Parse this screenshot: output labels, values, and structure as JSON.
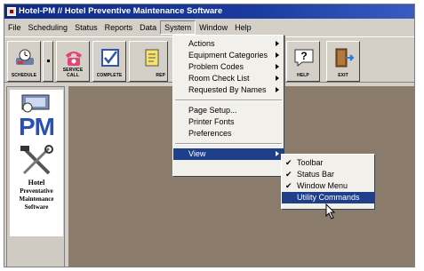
{
  "window": {
    "title": "Hotel-PM // Hotel Preventive Maintenance Software"
  },
  "menubar": {
    "items": [
      "File",
      "Scheduling",
      "Status",
      "Reports",
      "Data",
      "System",
      "Window",
      "Help"
    ]
  },
  "toolbar": {
    "schedule_label": "SCHEDULE",
    "service_call_label": "SERVICE CALL",
    "complete_label": "COMPLETE",
    "reports_label": "REP",
    "help_label": "HELP",
    "exit_label": "EXIT"
  },
  "logo": {
    "letters": "PM",
    "line1": "Hotel",
    "line2": "Preventative",
    "line3": "Maintenance",
    "line4": "Software"
  },
  "system_menu": {
    "group1": [
      "Actions",
      "Equipment Categories",
      "Problem Codes",
      "Room Check List",
      "Requested By Names"
    ],
    "group2": [
      "Page Setup...",
      "Printer Fonts",
      "Preferences"
    ],
    "view_label": "View"
  },
  "view_menu": {
    "items": [
      {
        "label": "Toolbar",
        "checked": true
      },
      {
        "label": "Status Bar",
        "checked": true
      },
      {
        "label": "Window Menu",
        "checked": true
      },
      {
        "label": "Utility Commands",
        "checked": false
      }
    ]
  },
  "colors": {
    "titlebar": "#0e2b86",
    "highlight": "#1f3f8a",
    "client_bg": "#8a7b6a",
    "logo_blue": "#2a4fb8"
  }
}
